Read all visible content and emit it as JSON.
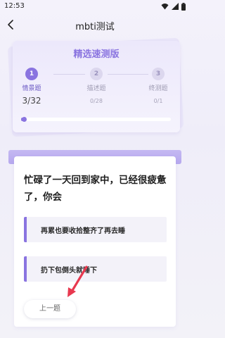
{
  "status_bar": {
    "time": "12:53",
    "icons": [
      "wifi-icon",
      "signal-icon",
      "battery-icon"
    ]
  },
  "nav": {
    "title": "mbti测试",
    "back_icon": "chevron-left-icon"
  },
  "progress_card": {
    "title": "精选速测版",
    "steps": [
      {
        "number": "1",
        "label": "情景题",
        "count": "3/32",
        "active": true
      },
      {
        "number": "2",
        "label": "描述题",
        "count": "0/28",
        "active": false
      },
      {
        "number": "3",
        "label": "终测题",
        "count": "0/1",
        "active": false
      }
    ],
    "progress_fraction": 0.02
  },
  "question": {
    "text": "忙碌了一天回到家中，已经很疲惫了，你会",
    "options": [
      {
        "label": "再累也要收拾整齐了再去睡"
      },
      {
        "label": "扔下包倒头就睡下"
      }
    ],
    "prev_label": "上一题"
  },
  "colors": {
    "accent": "#8a74e0",
    "annotation_arrow": "#e8384f"
  }
}
